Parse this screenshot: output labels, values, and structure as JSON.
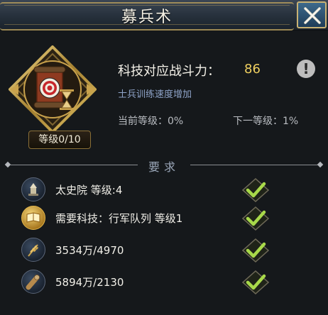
{
  "window": {
    "title": "募兵术",
    "close_icon": "close-x-icon"
  },
  "tech": {
    "emblem_icon": "target-scroll-hourglass-icon",
    "level_label": "等级0/10",
    "power_label": "科技对应战斗力：",
    "power_value": "86",
    "info_icon": "exclamation-icon",
    "description": "士兵训练速度增加",
    "current_level": "当前等级：0%",
    "next_level": "下一等级：1%"
  },
  "requirements": {
    "title": "要求",
    "items": [
      {
        "icon": "bell-tower-icon",
        "text": "太史院  等级:4",
        "met": true
      },
      {
        "icon": "book-icon",
        "text": "需要科技：行军队列  等级1",
        "met": true
      },
      {
        "icon": "wheat-icon",
        "text": "3534万/4970",
        "met": true
      },
      {
        "icon": "log-icon",
        "text": "5894万/2130",
        "met": true
      }
    ]
  },
  "colors": {
    "accent_gold": "#c9b274",
    "power_value": "#f0d060",
    "description": "#8fa4c9",
    "check_green": "#a8d94a"
  }
}
